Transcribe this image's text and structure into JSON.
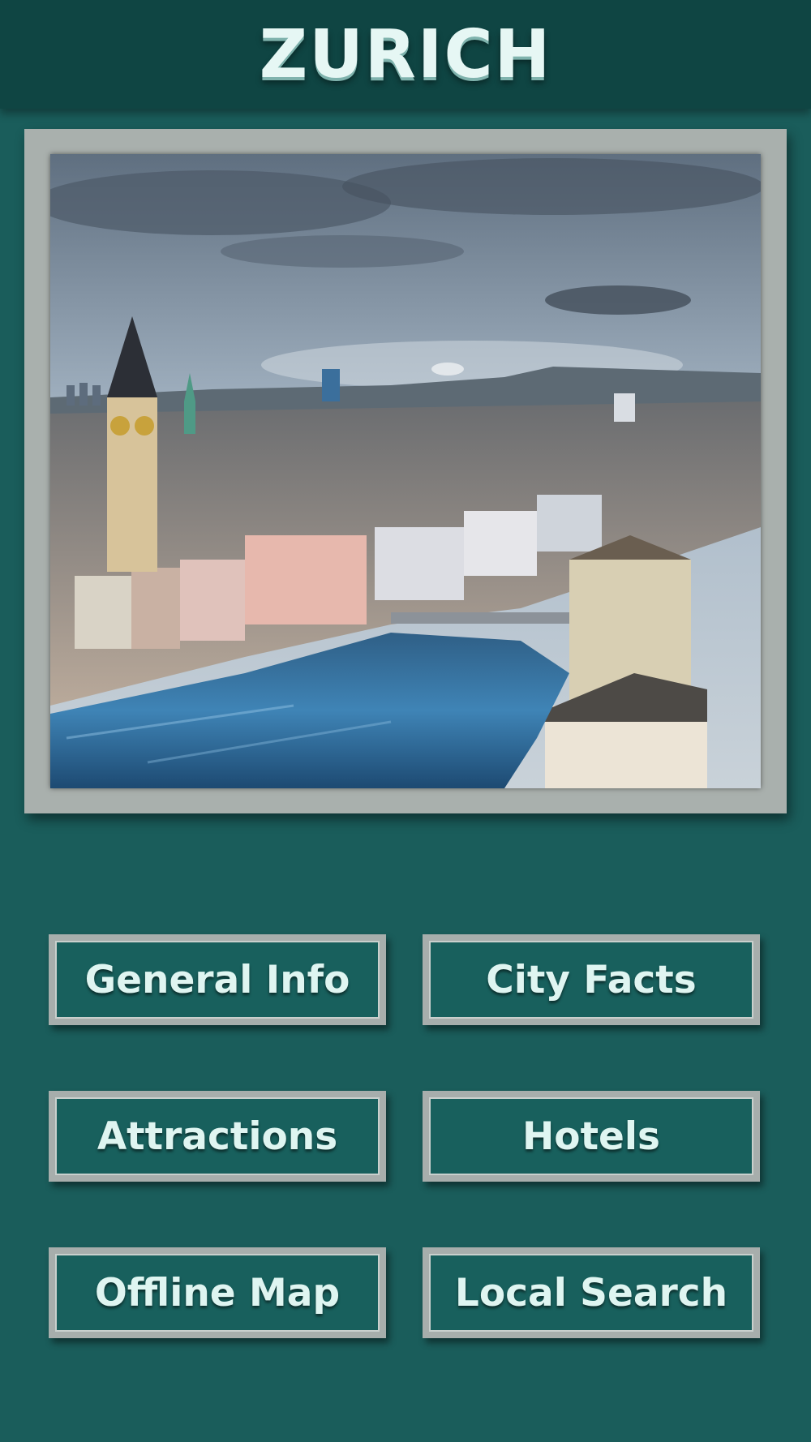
{
  "header": {
    "title": "ZURICH"
  },
  "hero": {
    "image_subject": "Zurich city skyline along the Limmat river"
  },
  "menu": {
    "general_info": "General Info",
    "city_facts": "City Facts",
    "attractions": "Attractions",
    "hotels": "Hotels",
    "offline_map": "Offline Map",
    "local_search": "Local Search"
  },
  "colors": {
    "background": "#1a5d5b",
    "header": "#0f4543",
    "button_border": "#a7aeac",
    "text": "#dff5f1"
  }
}
